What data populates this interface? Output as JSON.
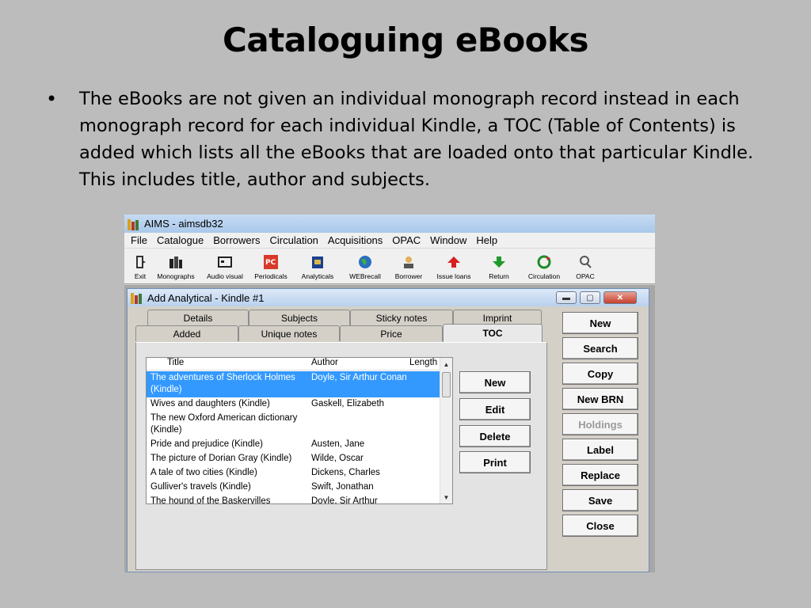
{
  "slide": {
    "title": "Cataloguing eBooks",
    "bullet": "•",
    "text": "The eBooks are not given an individual monograph record instead in each monograph record for each individual Kindle, a TOC (Table of Contents) is added which lists all the eBooks that are loaded onto that particular Kindle. This includes title, author and subjects."
  },
  "app": {
    "title": "AIMS - aimsdb32",
    "menu": [
      "File",
      "Catalogue",
      "Borrowers",
      "Circulation",
      "Acquisitions",
      "OPAC",
      "Window",
      "Help"
    ],
    "toolbar": [
      {
        "label": "Exit",
        "icon": "exit-icon"
      },
      {
        "label": "Monographs",
        "icon": "monographs-icon"
      },
      {
        "label": "Audio visual",
        "icon": "audio-visual-icon"
      },
      {
        "label": "Periodicals",
        "icon": "periodicals-icon"
      },
      {
        "label": "Analyticals",
        "icon": "analyticals-icon"
      },
      {
        "label": "WEBrecall",
        "icon": "globe-icon"
      },
      {
        "label": "Borrower",
        "icon": "borrower-icon"
      },
      {
        "label": "Issue loans",
        "icon": "issue-loans-icon"
      },
      {
        "label": "Return",
        "icon": "return-icon"
      },
      {
        "label": "Circulation",
        "icon": "circulation-icon"
      },
      {
        "label": "OPAC",
        "icon": "opac-search-icon"
      }
    ]
  },
  "dialog": {
    "title": "Add Analytical - Kindle #1",
    "tabs_back": [
      "Details",
      "Subjects",
      "Sticky notes",
      "Imprint"
    ],
    "tabs_front": [
      "Added",
      "Unique notes",
      "Price",
      "TOC"
    ],
    "active_tab": "TOC",
    "list": {
      "headers": [
        "Title",
        "Author",
        "Length"
      ],
      "rows": [
        {
          "title": "The adventures of Sherlock Holmes (Kindle)",
          "author": "Doyle, Sir Arthur Conan",
          "selected": true
        },
        {
          "title": "Wives and daughters (Kindle)",
          "author": "Gaskell, Elizabeth"
        },
        {
          "title": "The new Oxford American dictionary (Kindle)",
          "author": ""
        },
        {
          "title": "Pride and prejudice (Kindle)",
          "author": "Austen, Jane"
        },
        {
          "title": "The picture of Dorian Gray (Kindle)",
          "author": "Wilde, Oscar"
        },
        {
          "title": "A tale of two cities (Kindle)",
          "author": "Dickens, Charles"
        },
        {
          "title": "Gulliver's travels (Kindle)",
          "author": "Swift, Jonathan"
        },
        {
          "title": "The hound of the Baskervilles",
          "author": "Doyle, Sir Arthur"
        }
      ]
    },
    "toc_buttons": [
      "New",
      "Edit",
      "Delete",
      "Print"
    ],
    "side_buttons": [
      {
        "label": "New",
        "disabled": false
      },
      {
        "label": "Search",
        "disabled": false
      },
      {
        "label": "Copy",
        "disabled": false
      },
      {
        "label": "New BRN",
        "disabled": false
      },
      {
        "label": "Holdings",
        "disabled": true
      },
      {
        "label": "Label",
        "disabled": false
      },
      {
        "label": "Replace",
        "disabled": false
      },
      {
        "label": "Save",
        "disabled": false
      },
      {
        "label": "Close",
        "disabled": false
      }
    ]
  },
  "colors": {
    "selection": "#3399ff",
    "background": "#bcbcbc",
    "dialog": "#d4d0c8"
  }
}
